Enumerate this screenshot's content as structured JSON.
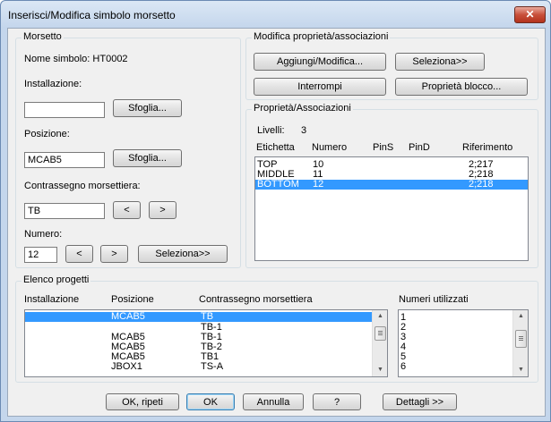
{
  "window": {
    "title": "Inserisci/Modifica simbolo morsetto",
    "close_glyph": "✕"
  },
  "morsetto": {
    "group_label": "Morsetto",
    "nome_simbolo": "Nome simbolo: HT0002",
    "installazione_label": "Installazione:",
    "installazione_value": "",
    "sfoglia_label": "Sfoglia...",
    "posizione_label": "Posizione:",
    "posizione_value": "MCAB5",
    "contrassegno_label": "Contrassegno morsettiera:",
    "contrassegno_value": "TB",
    "prev_label": "<",
    "next_label": ">",
    "numero_label": "Numero:",
    "numero_value": "12",
    "seleziona_label": "Seleziona>>"
  },
  "modifica": {
    "group_label": "Modifica proprietà/associazioni",
    "aggiungi_label": "Aggiungi/Modifica...",
    "seleziona_label": "Seleziona>>",
    "interrompi_label": "Interrompi",
    "proprieta_blocco_label": "Proprietà blocco..."
  },
  "proprieta": {
    "group_label": "Proprietà/Associazioni",
    "livelli_label": "Livelli:",
    "livelli_value": "3",
    "columns": [
      "Etichetta",
      "Numero",
      "PinS",
      "PinD",
      "Riferimento"
    ],
    "rows": [
      {
        "etichetta": "TOP",
        "numero": "10",
        "pins": "",
        "pind": "",
        "riferimento": "2;217",
        "selected": false
      },
      {
        "etichetta": "MIDDLE",
        "numero": "11",
        "pins": "",
        "pind": "",
        "riferimento": "2;218",
        "selected": false
      },
      {
        "etichetta": "BOTTOM",
        "numero": "12",
        "pins": "",
        "pind": "",
        "riferimento": "2;218",
        "selected": true
      }
    ]
  },
  "progetti": {
    "group_label": "Elenco progetti",
    "columns": [
      "Installazione",
      "Posizione",
      "Contrassegno morsettiera"
    ],
    "numeri_label": "Numeri utilizzati",
    "rows": [
      {
        "installazione": "",
        "posizione": "MCAB5",
        "contrassegno": "TB",
        "selected": true
      },
      {
        "installazione": "",
        "posizione": "",
        "contrassegno": "TB-1",
        "selected": false
      },
      {
        "installazione": "",
        "posizione": "MCAB5",
        "contrassegno": "TB-1",
        "selected": false
      },
      {
        "installazione": "",
        "posizione": "MCAB5",
        "contrassegno": "TB-2",
        "selected": false
      },
      {
        "installazione": "",
        "posizione": "MCAB5",
        "contrassegno": "TB1",
        "selected": false
      },
      {
        "installazione": "",
        "posizione": "JBOX1",
        "contrassegno": "TS-A",
        "selected": false
      }
    ],
    "numeri": [
      "1",
      "2",
      "3",
      "4",
      "5",
      "6"
    ]
  },
  "footer": {
    "ok_ripeti": "OK, ripeti",
    "ok": "OK",
    "annulla": "Annulla",
    "help": "?",
    "dettagli": "Dettagli >>"
  }
}
